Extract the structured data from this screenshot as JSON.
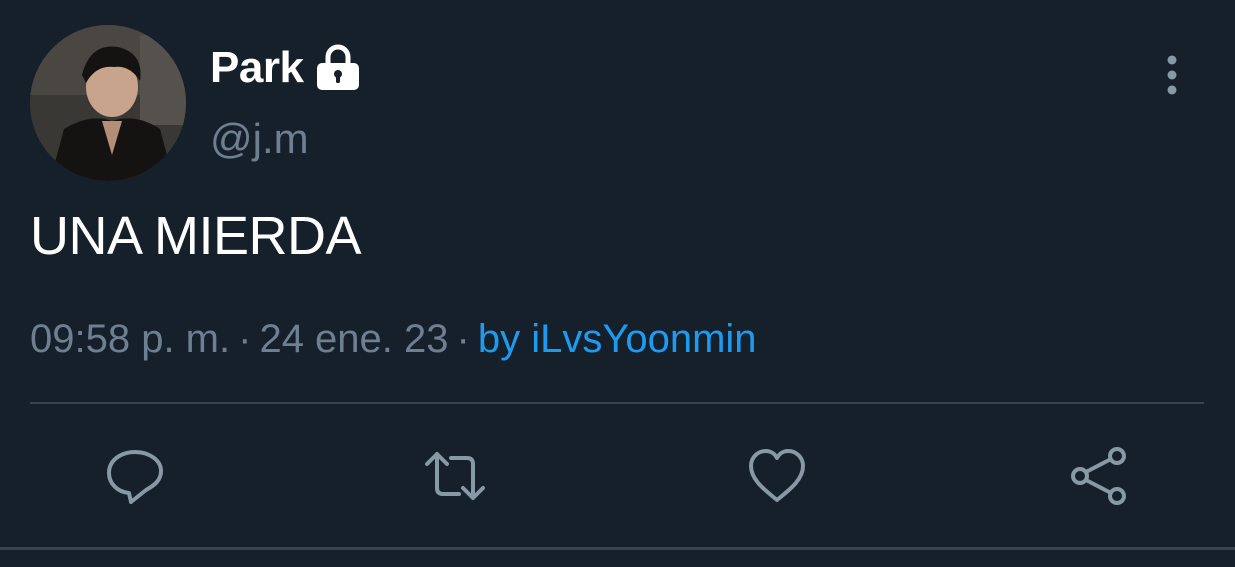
{
  "user": {
    "display_name": "Park",
    "handle": "@j.m",
    "avatar_icon": "avatar-photo",
    "protected_icon": "lock-icon"
  },
  "tweet": {
    "text": "UNA MIERDA",
    "time": "09:58 p. m.",
    "separator": "·",
    "date": "24 ene. 23",
    "source": "by iLvsYoonmin"
  },
  "actions": {
    "reply_icon": "reply-icon",
    "retweet_icon": "retweet-icon",
    "like_icon": "heart-icon",
    "share_icon": "share-icon"
  },
  "colors": {
    "background": "#15202b",
    "primary_text": "#ffffff",
    "secondary_text": "#6e7f91",
    "link": "#1d9bf0",
    "divider": "#38444d"
  }
}
